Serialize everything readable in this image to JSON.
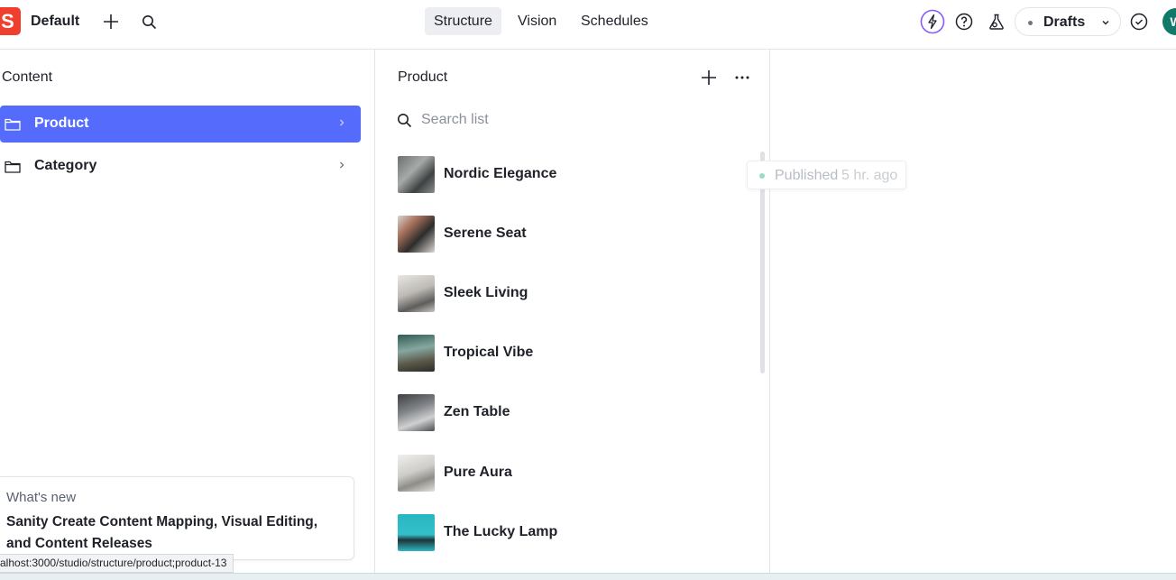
{
  "header": {
    "logo_letter": "S",
    "workspace": "Default",
    "tabs": [
      {
        "label": "Structure",
        "active": true
      },
      {
        "label": "Vision",
        "active": false
      },
      {
        "label": "Schedules",
        "active": false
      }
    ],
    "drafts_label": "Drafts",
    "avatar_initial": "W",
    "colors": {
      "logo": "#f03e2f",
      "lightning": "#8a5cf6",
      "avatar": "#0f7a6a"
    }
  },
  "content_pane": {
    "title": "Content",
    "items": [
      {
        "label": "Product",
        "selected": true
      },
      {
        "label": "Category",
        "selected": false
      }
    ],
    "selected_color": "#556bfc"
  },
  "product_pane": {
    "title": "Product",
    "search_placeholder": "Search list",
    "documents": [
      {
        "title": "Nordic Elegance"
      },
      {
        "title": "Serene Seat"
      },
      {
        "title": "Sleek Living"
      },
      {
        "title": "Tropical Vibe"
      },
      {
        "title": "Zen Table"
      },
      {
        "title": "Pure Aura"
      },
      {
        "title": "The Lucky Lamp"
      }
    ]
  },
  "tooltip": {
    "status": "Published",
    "time": "5 hr. ago"
  },
  "whats_new": {
    "kicker": "What's new",
    "title": "Sanity Create Content Mapping, Visual Editing, and Content Releases"
  },
  "status_bar": {
    "url": "alhost:3000/studio/structure/product;product-13"
  }
}
